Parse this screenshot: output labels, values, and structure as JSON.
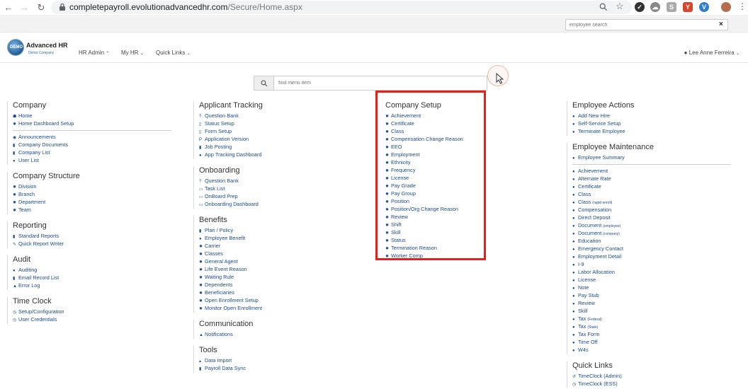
{
  "browser": {
    "url_host": "completepayroll.evolutionadvancedhr.com",
    "url_path": "/Secure/Home.aspx"
  },
  "header": {
    "employee_search_placeholder": "employee search",
    "brand_name": "Advanced HR",
    "brand_sub": "Demo Company",
    "logo_text": "DEMO",
    "menus": [
      "HR Admin",
      "My HR",
      "Quick Links"
    ],
    "user": "Lee Anne Ferreira"
  },
  "search": {
    "placeholder": "find menu item"
  },
  "col1": {
    "company": {
      "title": "Company",
      "items": [
        "Home",
        "Home Dashboard Setup"
      ],
      "items2": [
        "Announcements",
        "Company Documents",
        "Company List",
        "User List"
      ]
    },
    "structure": {
      "title": "Company Structure",
      "items": [
        "Division",
        "Branch",
        "Department",
        "Team"
      ]
    },
    "reporting": {
      "title": "Reporting",
      "items": [
        "Standard Reports",
        "Quick Report Writer"
      ]
    },
    "audit": {
      "title": "Audit",
      "items": [
        "Auditing",
        "Email Record List",
        "Error Log"
      ]
    },
    "timeclock": {
      "title": "Time Clock",
      "items": [
        "Setup/Configuration",
        "User Credentials"
      ]
    }
  },
  "col2": {
    "applicant": {
      "title": "Applicant Tracking",
      "items": [
        "Question Bank",
        "Status Setup",
        "Form Setup",
        "Application Version",
        "Job Posting",
        "App Tracking Dashboard"
      ]
    },
    "onboarding": {
      "title": "Onboarding",
      "items": [
        "Question Bank",
        "Task List",
        "OnBoard Prep",
        "Onboarding Dashboard"
      ]
    },
    "benefits": {
      "title": "Benefits",
      "items": [
        "Plan / Policy",
        "Employee Benefit",
        "Carrier",
        "Classes",
        "General Agent",
        "Life Event Reason",
        "Waiting Rule",
        "Dependents",
        "Beneficiaries",
        "Open Enrollment Setup",
        "Monitor Open Enrollment"
      ]
    },
    "communication": {
      "title": "Communication",
      "items": [
        "Notifications"
      ]
    },
    "tools": {
      "title": "Tools",
      "items": [
        "Data Import",
        "Payroll Data Sync"
      ]
    }
  },
  "col3": {
    "setup": {
      "title": "Company Setup",
      "items": [
        "Achievement",
        "Certificate",
        "Class",
        "Compensation Change Reason",
        "EEO",
        "Employment",
        "Ethnicity",
        "Frequency",
        "License",
        "Pay Grade",
        "Pay Group",
        "Position",
        "Position/Org Change Reason",
        "Review",
        "Shift",
        "Skill",
        "Status",
        "Termination Reason",
        "Worker Comp"
      ]
    }
  },
  "col4": {
    "actions": {
      "title": "Employee Actions",
      "items": [
        "Add New Hire",
        "Self-Service Setup",
        "Terminate Employee"
      ]
    },
    "maintenance": {
      "title": "Employee Maintenance",
      "summary": "Employee Summary",
      "items": [
        {
          "label": "Achievement",
          "sub": ""
        },
        {
          "label": "Alternate Rate",
          "sub": ""
        },
        {
          "label": "Certificate",
          "sub": ""
        },
        {
          "label": "Class",
          "sub": ""
        },
        {
          "label": "Class",
          "sub": "(rapid enroll)"
        },
        {
          "label": "Compensation",
          "sub": ""
        },
        {
          "label": "Direct Deposit",
          "sub": ""
        },
        {
          "label": "Document",
          "sub": "(employee)"
        },
        {
          "label": "Document",
          "sub": "(company)"
        },
        {
          "label": "Education",
          "sub": ""
        },
        {
          "label": "Emergency Contact",
          "sub": ""
        },
        {
          "label": "Employment Detail",
          "sub": ""
        },
        {
          "label": "I-9",
          "sub": ""
        },
        {
          "label": "Labor Allocation",
          "sub": ""
        },
        {
          "label": "License",
          "sub": ""
        },
        {
          "label": "Note",
          "sub": ""
        },
        {
          "label": "Pay Stub",
          "sub": ""
        },
        {
          "label": "Review",
          "sub": ""
        },
        {
          "label": "Skill",
          "sub": ""
        },
        {
          "label": "Tax",
          "sub": "(Federal)"
        },
        {
          "label": "Tax",
          "sub": "(State)"
        },
        {
          "label": "Tax Form",
          "sub": ""
        },
        {
          "label": "Time Off",
          "sub": ""
        },
        {
          "label": "W4s",
          "sub": ""
        }
      ]
    },
    "quicklinks": {
      "title": "Quick Links",
      "items": [
        "TimeClock (Admin)",
        "TimeClock (ESS)"
      ]
    }
  },
  "colors": {
    "link": "#1a4c8c",
    "highlight": "#e3201b"
  }
}
